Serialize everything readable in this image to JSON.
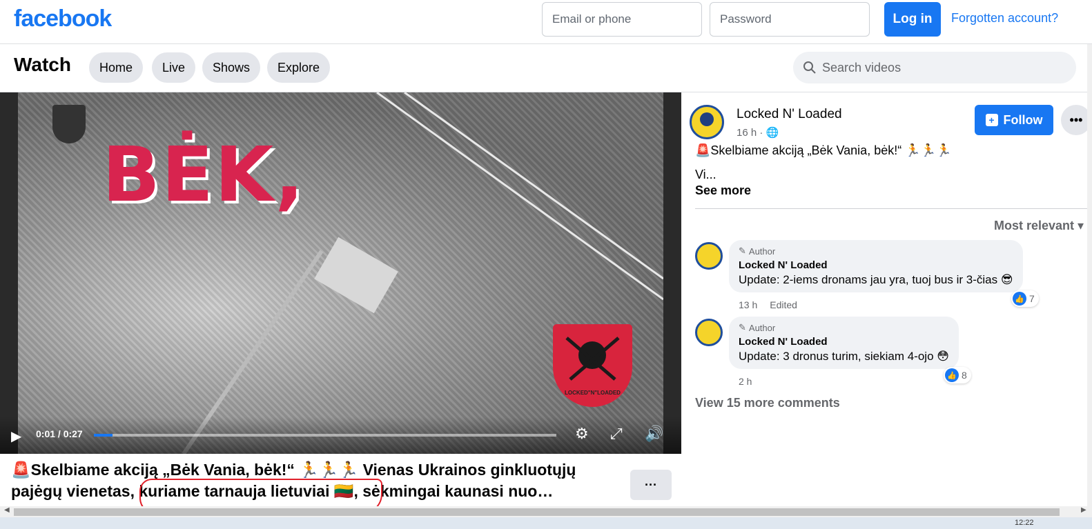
{
  "header": {
    "logo": "facebook",
    "email_placeholder": "Email or phone",
    "password_placeholder": "Password",
    "login_label": "Log in",
    "forgot_label": "Forgotten account?"
  },
  "watch": {
    "title": "Watch",
    "tabs": [
      {
        "label": "Home"
      },
      {
        "label": "Live"
      },
      {
        "label": "Shows"
      },
      {
        "label": "Explore"
      }
    ],
    "search_placeholder": "Search videos"
  },
  "video": {
    "overlay_text": "BĖK,",
    "shield_text": "LOCKED\"N\"LOADED",
    "time": "0:01 / 0:27",
    "progress": 0.04
  },
  "caption": {
    "line1": "🚨Skelbiame akciją „Bėk Vania, bėk!“ 🏃🏃🏃 Vienas Ukrainos ginkluotųjų",
    "line2": "pajėgų vienetas, kuriame tarnauja lietuviai 🇱🇹, sėkmingai kaunasi nuo…",
    "more_label": "···"
  },
  "post": {
    "page_name": "Locked N' Loaded",
    "time": "16 h · 🌐",
    "follow_label": "Follow",
    "more_label": "•••",
    "text": "🚨Skelbiame akciją „Bėk Vania, bėk!“ 🏃🏃🏃",
    "text2": "Vi...",
    "see_more": "See more",
    "sort_label": "Most relevant ▾"
  },
  "comments": [
    {
      "tag": "Author",
      "name": "Locked N' Loaded",
      "text": "Update: 2-iems dronams jau yra, tuoj bus ir 3-čias 😎",
      "time": "13 h",
      "edited": "Edited",
      "likes": "7"
    },
    {
      "tag": "Author",
      "name": "Locked N' Loaded",
      "text": "Update: 3 dronus turim, siekiam 4-ojo 😳",
      "time": "2 h",
      "edited": "",
      "likes": "8"
    }
  ],
  "view_more": "View 15 more comments",
  "taskbar": {
    "clock": "12:22"
  },
  "colors": {
    "brand": "#1877f2",
    "annotation": "#e0202a"
  }
}
